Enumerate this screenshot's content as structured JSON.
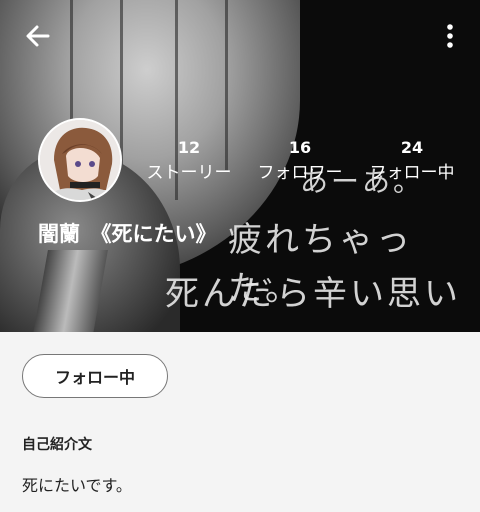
{
  "header": {
    "overlay_line1": "あーあ。",
    "overlay_line2": "疲れちゃった。",
    "overlay_line3": "死んだら辛い思い",
    "username": "闇蘭　《死にたい》"
  },
  "stats": [
    {
      "count": "12",
      "label": "ストーリー"
    },
    {
      "count": "16",
      "label": "フォロワー"
    },
    {
      "count": "24",
      "label": "フォロー中"
    }
  ],
  "actions": {
    "follow_label": "フォロー中"
  },
  "bio": {
    "title": "自己紹介文",
    "text": "死にたいです。"
  },
  "icons": {
    "back": "arrow-left-icon",
    "more": "vertical-dots-icon"
  },
  "colors": {
    "header_bg": "#0b0b0b",
    "panel_bg": "#f4f4f4",
    "button_border": "#777777"
  }
}
